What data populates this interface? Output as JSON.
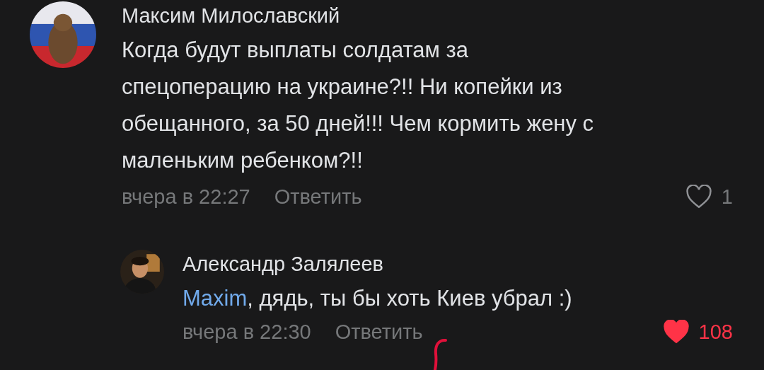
{
  "comments": [
    {
      "author": "Максим Милославский",
      "text": "Когда будут выплаты солдатам за\nспецоперацию на украине?!!  Ни копейки из\nобещанного, за 50 дней!!! Чем кормить жену с\nмаленьким ребенком?!!",
      "time": "вчера в 22:27",
      "reply": "Ответить",
      "liked": false,
      "likes": "1",
      "replies": [
        {
          "author": "Александр Залялеев",
          "mention": "Maxim",
          "text": ", дядь, ты бы хоть Киев убрал :)",
          "time": "вчера в 22:30",
          "reply": "Ответить",
          "liked": true,
          "likes": "108"
        }
      ]
    }
  ]
}
